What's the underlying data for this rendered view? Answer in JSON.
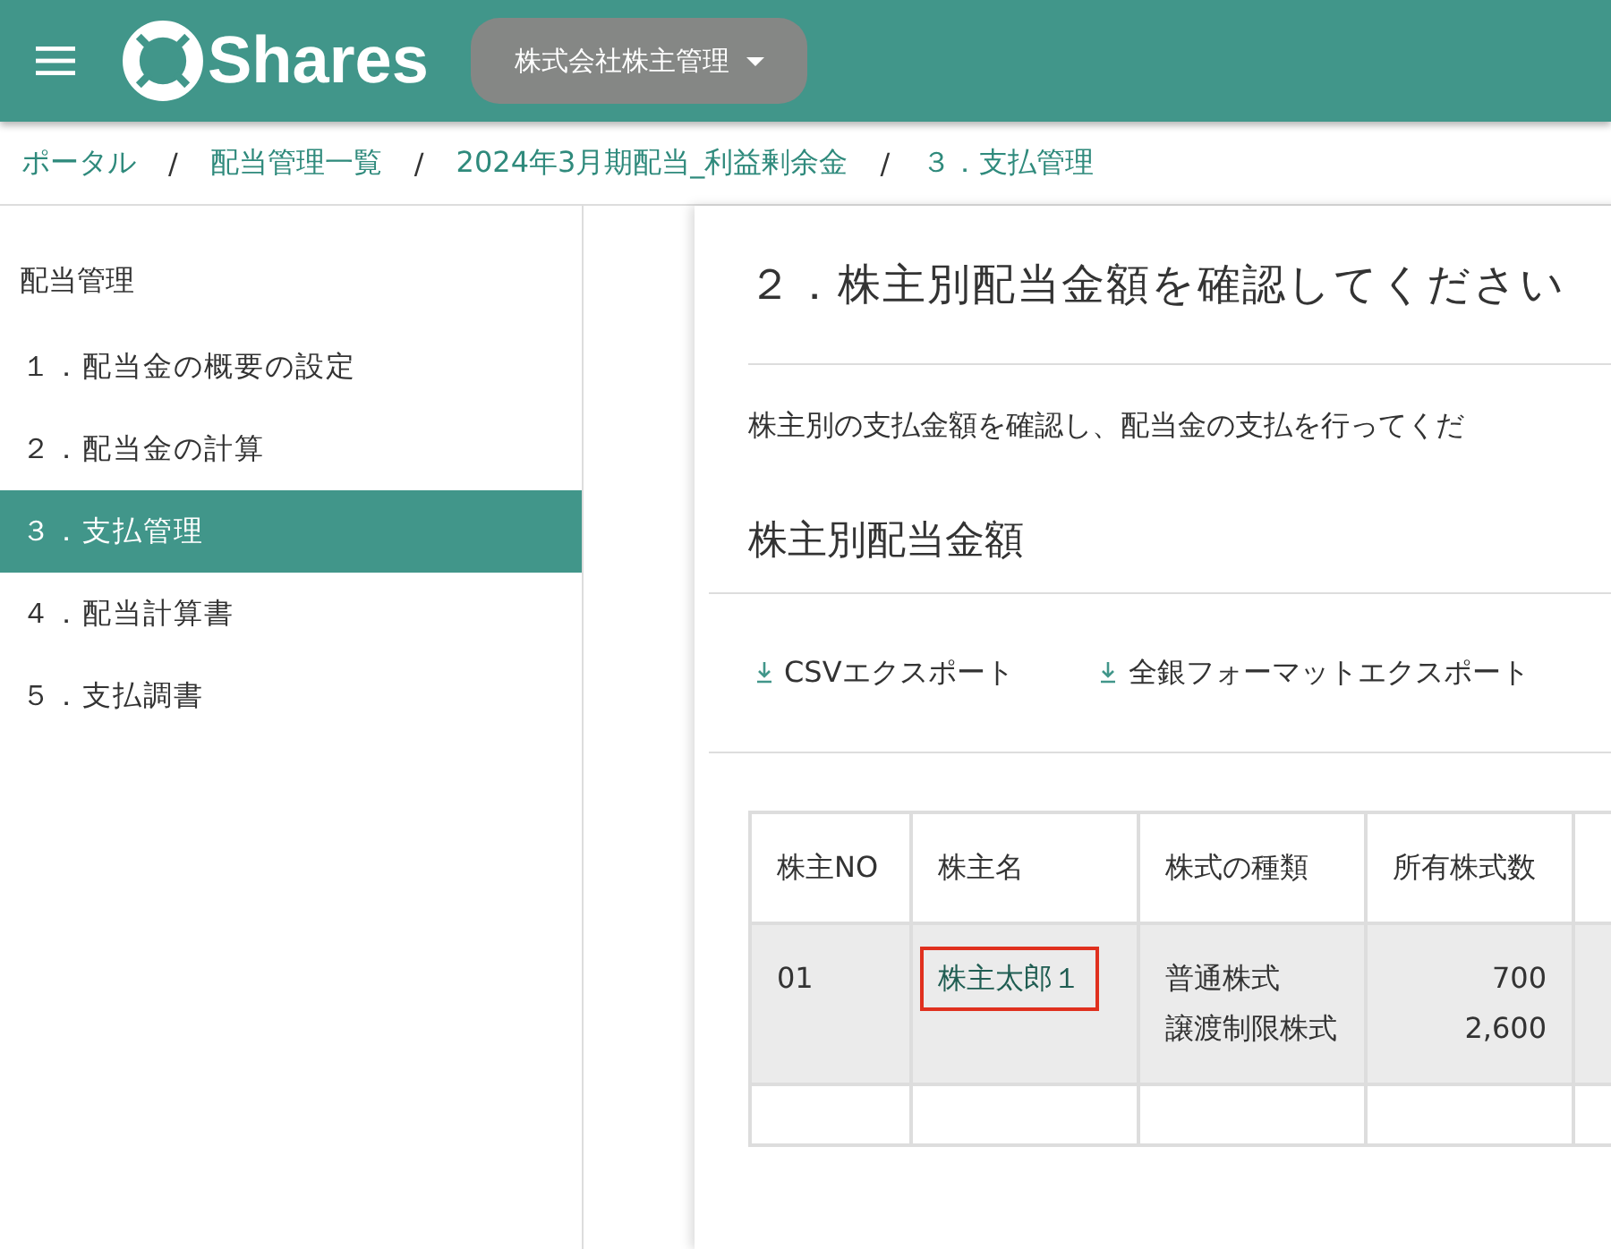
{
  "header": {
    "brand": "Shares",
    "company": "株式会社株主管理"
  },
  "breadcrumb": {
    "separator": "/",
    "items": [
      "ポータル",
      "配当管理一覧",
      "2024年3月期配当_利益剰余金",
      "３．支払管理"
    ]
  },
  "sidebar": {
    "heading": "配当管理",
    "items": [
      {
        "label": "１．配当金の概要の設定",
        "selected": false
      },
      {
        "label": "２．配当金の計算",
        "selected": false
      },
      {
        "label": "３．支払管理",
        "selected": true
      },
      {
        "label": "４．配当計算書",
        "selected": false
      },
      {
        "label": "５．支払調書",
        "selected": false
      }
    ]
  },
  "main": {
    "title": "２．株主別配当金額を確認してください",
    "description": "株主別の支払金額を確認し、配当金の支払を行ってくだ",
    "section_title": "株主別配当金額",
    "exports": [
      "CSVエクスポート",
      "全銀フォーマットエクスポート"
    ],
    "table": {
      "columns": [
        "株主NO",
        "株主名",
        "株式の種類",
        "所有株式数"
      ],
      "rows": [
        {
          "no": "01",
          "name": "株主太郎１",
          "highlighted": true,
          "share_types": [
            "普通株式",
            "譲渡制限株式"
          ],
          "shares": [
            "700",
            "2,600"
          ]
        }
      ]
    }
  }
}
